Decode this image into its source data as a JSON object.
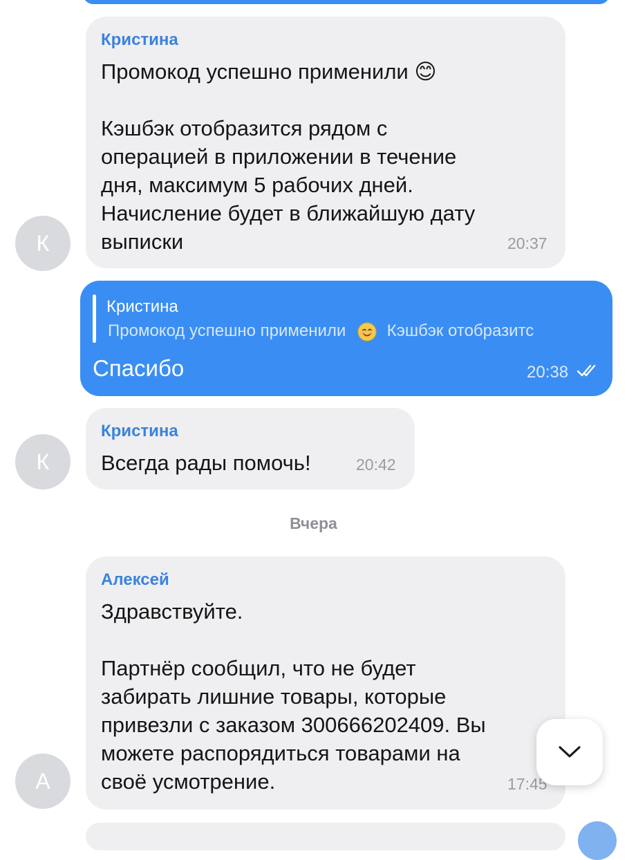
{
  "messages": [
    {
      "avatar_initial": "К",
      "sender": "Кристина",
      "text": "Промокод успешно применили 😊\n\nКэшбэк отобразится рядом с\nоперацией в приложении в течение\nдня, максимум 5 рабочих дней.\nНачисление будет в ближайшую дату\nвыписки",
      "time": "20:37"
    },
    {
      "outgoing": true,
      "reply_to": {
        "name": "Кристина",
        "snippet_start": "Промокод успешно применили",
        "snippet_end": "Кэшбэк отобразитс"
      },
      "text": "Спасибо",
      "time": "20:38",
      "status_icon": "double-check-icon"
    },
    {
      "avatar_initial": "К",
      "sender": "Кристина",
      "text": "Всегда рады помочь!",
      "time": "20:42"
    },
    {
      "avatar_initial": "А",
      "sender": "Алексей",
      "text": "Здравствуйте.\n\nПартнёр сообщил, что не будет\nзабирать лишние товары, которые\nпривезли с заказом 300666202409. Вы\nможете распорядиться товарами на\nсвоё усмотрение.",
      "time": "17:45"
    }
  ],
  "date_divider": "Вчера",
  "colors": {
    "accent_blue": "#3a8ef3",
    "sender_name": "#3b82dc",
    "incoming_bubble": "#efeff2",
    "avatar_bg": "#d9dade"
  },
  "scroll_button_icon": "chevron-down-icon"
}
